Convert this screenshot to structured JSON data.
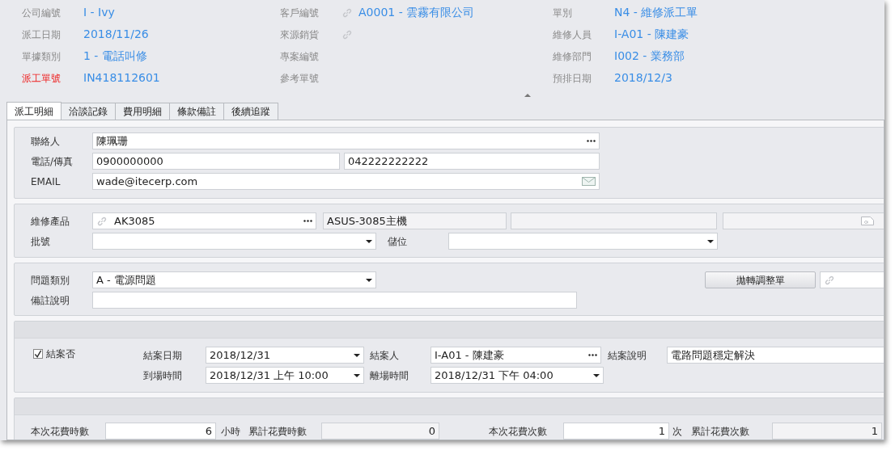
{
  "header": {
    "columns": [
      [
        {
          "label": "公司編號",
          "value": "I - Ivy",
          "required": false,
          "linked": false
        },
        {
          "label": "派工日期",
          "value": "2018/11/26",
          "required": false,
          "linked": false
        },
        {
          "label": "單據類別",
          "value": "1 - 電話叫修",
          "required": false,
          "linked": false
        },
        {
          "label": "派工單號",
          "value": "IN418112601",
          "required": true,
          "linked": false
        }
      ],
      [
        {
          "label": "客戶編號",
          "value": "A0001 - 雲霧有限公司",
          "required": false,
          "linked": true
        },
        {
          "label": "來源銷貨",
          "required": false,
          "linked": true
        },
        {
          "label": "專案編號",
          "required": false,
          "linked": false
        },
        {
          "label": "參考單號",
          "required": false,
          "linked": false
        }
      ],
      [
        {
          "label": "單別",
          "value": "N4 - 維修派工單",
          "required": false,
          "linked": false
        },
        {
          "label": "維修人員",
          "value": "I-A01 - 陳建豪",
          "required": false,
          "linked": false
        },
        {
          "label": "維修部門",
          "value": "I002 - 業務部",
          "required": false,
          "linked": false
        },
        {
          "label": "預排日期",
          "value": "2018/12/3",
          "required": false,
          "linked": false
        }
      ]
    ]
  },
  "tabs": [
    {
      "label": "派工明細",
      "selected": true
    },
    {
      "label": "洽談記錄",
      "selected": false
    },
    {
      "label": "費用明細",
      "selected": false
    },
    {
      "label": "條款備註",
      "selected": false
    },
    {
      "label": "後續追蹤",
      "selected": false
    }
  ],
  "sections": [
    {
      "band": false,
      "rows": [
        [
          {
            "kind": "label",
            "text": "聯絡人"
          },
          {
            "kind": "lookup",
            "value": "陳珮珊"
          }
        ],
        [
          {
            "kind": "label",
            "text": "電話/傳真"
          },
          {
            "kind": "input",
            "value": "0900000000"
          },
          {
            "kind": "input",
            "value": "042222222222"
          }
        ],
        [
          {
            "kind": "label",
            "text": "EMAIL"
          },
          {
            "kind": "email",
            "value": "wade@itecerp.com"
          }
        ]
      ]
    },
    {
      "band": false,
      "rows": [
        [
          {
            "kind": "label",
            "text": "維修產品"
          },
          {
            "kind": "linklookup",
            "value": "AK3085"
          },
          {
            "kind": "readonly",
            "value": "ASUS-3085主機"
          },
          {
            "kind": "readonly"
          },
          {
            "kind": "notefield"
          }
        ],
        [
          {
            "kind": "label",
            "text": "批號"
          },
          {
            "kind": "select"
          },
          {
            "kind": "label",
            "text": "儲位"
          },
          {
            "kind": "select"
          }
        ]
      ]
    },
    {
      "band": false,
      "rows": [
        [
          {
            "kind": "label",
            "text": "問題類別"
          },
          {
            "kind": "select",
            "value": "A - 電源問題"
          },
          {
            "kind": "button",
            "text": "拋轉調整單"
          },
          {
            "kind": "linkfield"
          }
        ],
        [
          {
            "kind": "label",
            "text": "備註說明"
          },
          {
            "kind": "input"
          }
        ]
      ]
    },
    {
      "band": true,
      "rows": [
        [
          {
            "kind": "checkbox",
            "text": "結案否",
            "checked": true
          },
          {
            "kind": "label",
            "text": "結案日期"
          },
          {
            "kind": "select",
            "value": "2018/12/31"
          },
          {
            "kind": "label",
            "text": "結案人"
          },
          {
            "kind": "lookup",
            "value": "I-A01 - 陳建豪"
          },
          {
            "kind": "label",
            "text": "結案說明"
          },
          {
            "kind": "input",
            "value": "電路問題穩定解決"
          }
        ],
        [
          {
            "kind": "blank"
          },
          {
            "kind": "label",
            "text": "到場時間"
          },
          {
            "kind": "select",
            "value": "2018/12/31 上午 10:00"
          },
          {
            "kind": "label",
            "text": "離場時間"
          },
          {
            "kind": "select",
            "value": "2018/12/31 下午 04:00"
          }
        ]
      ]
    },
    {
      "band": true,
      "rows": [
        [
          {
            "kind": "label",
            "text": "本次花費時數"
          },
          {
            "kind": "number",
            "value": "6"
          },
          {
            "kind": "unit",
            "text": "小時"
          },
          {
            "kind": "label",
            "text": "累計花費時數"
          },
          {
            "kind": "readonlynumber",
            "value": "0"
          },
          {
            "kind": "label",
            "text": "本次花費次數"
          },
          {
            "kind": "number",
            "value": "1"
          },
          {
            "kind": "unit",
            "text": "次"
          },
          {
            "kind": "label",
            "text": "累計花費次數"
          },
          {
            "kind": "readonlynumber",
            "value": "1"
          }
        ]
      ]
    }
  ]
}
